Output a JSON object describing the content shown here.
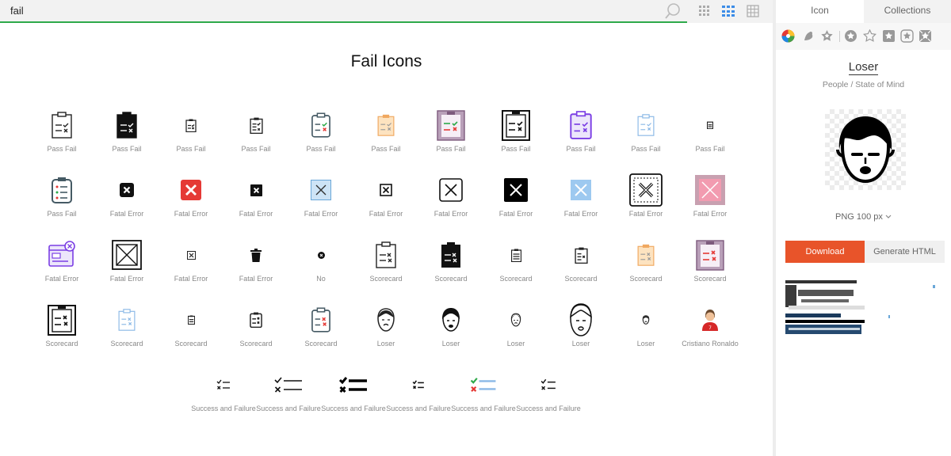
{
  "search": {
    "value": "fail",
    "placeholder": ""
  },
  "page_title": "Fail Icons",
  "icon_labels": {
    "pass_fail": "Pass Fail",
    "fatal_error": "Fatal Error",
    "no": "No",
    "scorecard": "Scorecard",
    "loser": "Loser",
    "cristiano": "Cristiano Ronaldo",
    "success_failure": "Success and Failure"
  },
  "sidebar": {
    "tabs": [
      "Icon",
      "Collections"
    ],
    "selected_icon": {
      "name": "Loser",
      "category": "People / State of Mind"
    },
    "format": "PNG 100 px",
    "download_label": "Download",
    "generate_html_label": "Generate HTML"
  },
  "colors": {
    "accent_green": "#2eaa4a",
    "download_orange": "#e8542a",
    "view_active_blue": "#3c8ce7"
  },
  "icons": [
    "search-icon",
    "grid-small-icon",
    "grid-medium-icon",
    "grid-table-icon",
    "clipboard-check-icon",
    "close-box-icon",
    "face-icon",
    "checklist-icon",
    "chevron-down-icon"
  ]
}
